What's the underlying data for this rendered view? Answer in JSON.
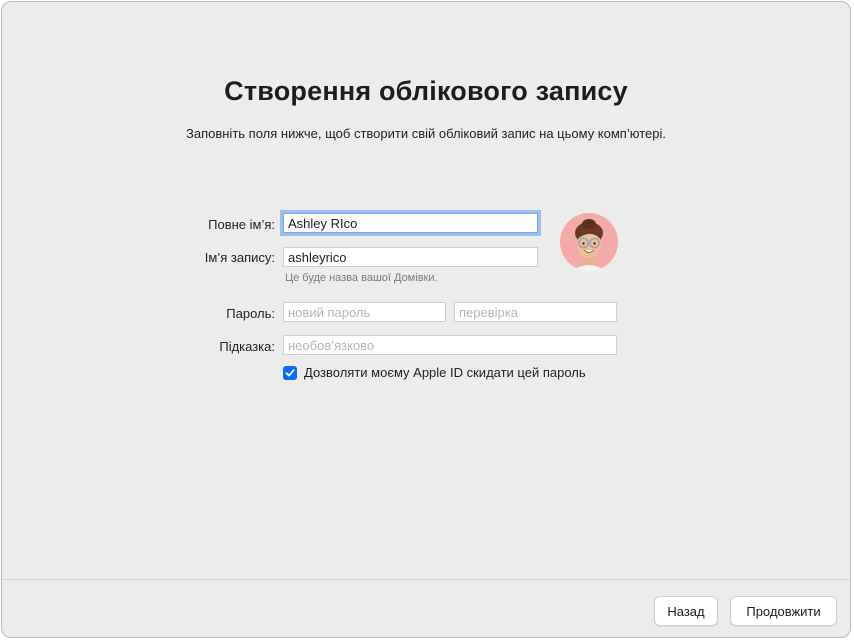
{
  "page": {
    "title": "Створення облікового запису",
    "subtitle": "Заповніть поля нижче, щоб створити свій обліковий запис на цьому комп’ютері."
  },
  "form": {
    "full_name_label": "Повне ім’я:",
    "full_name_value": "Ashley RIco",
    "account_name_label": "Ім’я запису:",
    "account_name_value": "ashleyrico",
    "account_hint": "Це буде назва вашої Домівки.",
    "password_label": "Пароль:",
    "password_placeholder": "новий пароль",
    "verify_placeholder": "перевірка",
    "hint_label": "Підказка:",
    "hint_placeholder": "необов’язково",
    "allow_reset_label": "Дозволяти моєму Apple ID скидати цей пароль",
    "allow_reset_checked": true
  },
  "footer": {
    "back_label": "Назад",
    "continue_label": "Продовжити"
  },
  "colors": {
    "accent": "#0a69ff",
    "focus_ring": "#9fbef0",
    "avatar_bg": "#f5aaa7"
  },
  "icons": {
    "avatar": "memoji-avatar-icon",
    "checkbox": "checkmark-icon"
  }
}
